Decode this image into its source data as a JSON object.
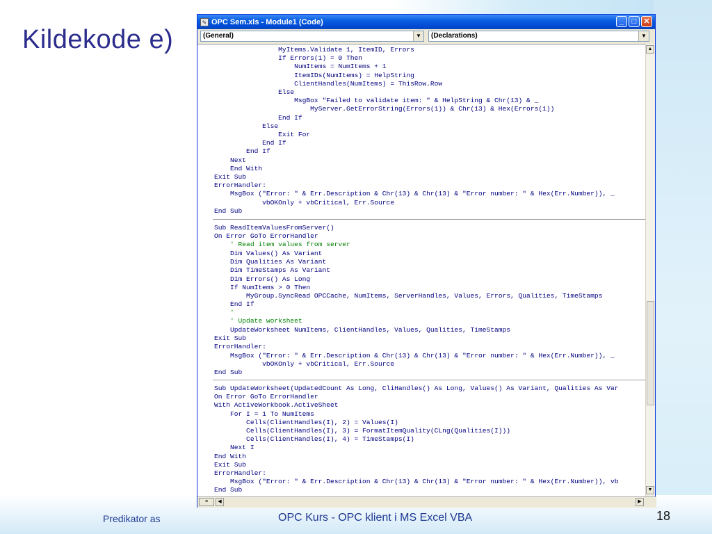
{
  "slide": {
    "title": "Kildekode e)",
    "footer_left": "Predikator as",
    "footer_center": "OPC Kurs - OPC klient i MS Excel VBA",
    "page_number": "18"
  },
  "window": {
    "title": "OPC Sem.xls - Module1 (Code)",
    "object_combo": "(General)",
    "procedure_combo": "(Declarations)"
  },
  "code": {
    "block1": "                MyItems.Validate 1, ItemID, Errors\n                If Errors(1) = 0 Then\n                    NumItems = NumItems + 1\n                    ItemIDs(NumItems) = HelpString\n                    ClientHandles(NumItems) = ThisRow.Row\n                Else\n                    MsgBox \"Failed to validate item: \" & HelpString & Chr(13) & _\n                        MyServer.GetErrorString(Errors(1)) & Chr(13) & Hex(Errors(1))\n                End If\n            Else\n                Exit For\n            End If\n        End If\n    Next\n    End With\nExit Sub\nErrorHandler:\n    MsgBox (\"Error: \" & Err.Description & Chr(13) & Chr(13) & \"Error number: \" & Hex(Err.Number)), _\n            vbOKOnly + vbCritical, Err.Source\nEnd Sub",
    "block2_pre": "Sub ReadItemValuesFromServer()\nOn Error GoTo ErrorHandler",
    "block2_comment1": "    ' Read item values from server",
    "block2_mid": "    Dim Values() As Variant\n    Dim Qualities As Variant\n    Dim TimeStamps As Variant\n    Dim Errors() As Long\n    If NumItems > 0 Then\n        MyGroup.SyncRead OPCCache, NumItems, ServerHandles, Values, Errors, Qualities, TimeStamps\n    End If",
    "block2_comment2": "    '\n    ' Update worksheet",
    "block2_post": "    UpdateWorksheet NumItems, ClientHandles, Values, Qualities, TimeStamps\nExit Sub\nErrorHandler:\n    MsgBox (\"Error: \" & Err.Description & Chr(13) & Chr(13) & \"Error number: \" & Hex(Err.Number)), _\n            vbOKOnly + vbCritical, Err.Source\nEnd Sub",
    "block3": "Sub UpdateWorksheet(UpdatedCount As Long, CliHandles() As Long, Values() As Variant, Qualities As Var\nOn Error GoTo ErrorHandler\nWith ActiveWorkbook.ActiveSheet\n    For I = 1 To NumItems\n        Cells(ClientHandles(I), 2) = Values(I)\n        Cells(ClientHandles(I), 3) = FormatItemQuality(CLng(Qualities(I)))\n        Cells(ClientHandles(I), 4) = TimeStamps(I)\n    Next I\nEnd With\nExit Sub\nErrorHandler:\n    MsgBox (\"Error: \" & Err.Description & Chr(13) & Chr(13) & \"Error number: \" & Hex(Err.Number)), vb\nEnd Sub"
  },
  "icons": [
    "app-icon",
    "minimize-icon",
    "maximize-icon",
    "close-icon",
    "dropdown-arrow-icon",
    "scroll-up-icon",
    "scroll-down-icon",
    "scroll-left-icon",
    "scroll-right-icon"
  ],
  "colors": {
    "code_text": "#00007f",
    "comment": "#007f00",
    "title_blue": "#2b2c8c",
    "titlebar": "#0a5ee0"
  }
}
